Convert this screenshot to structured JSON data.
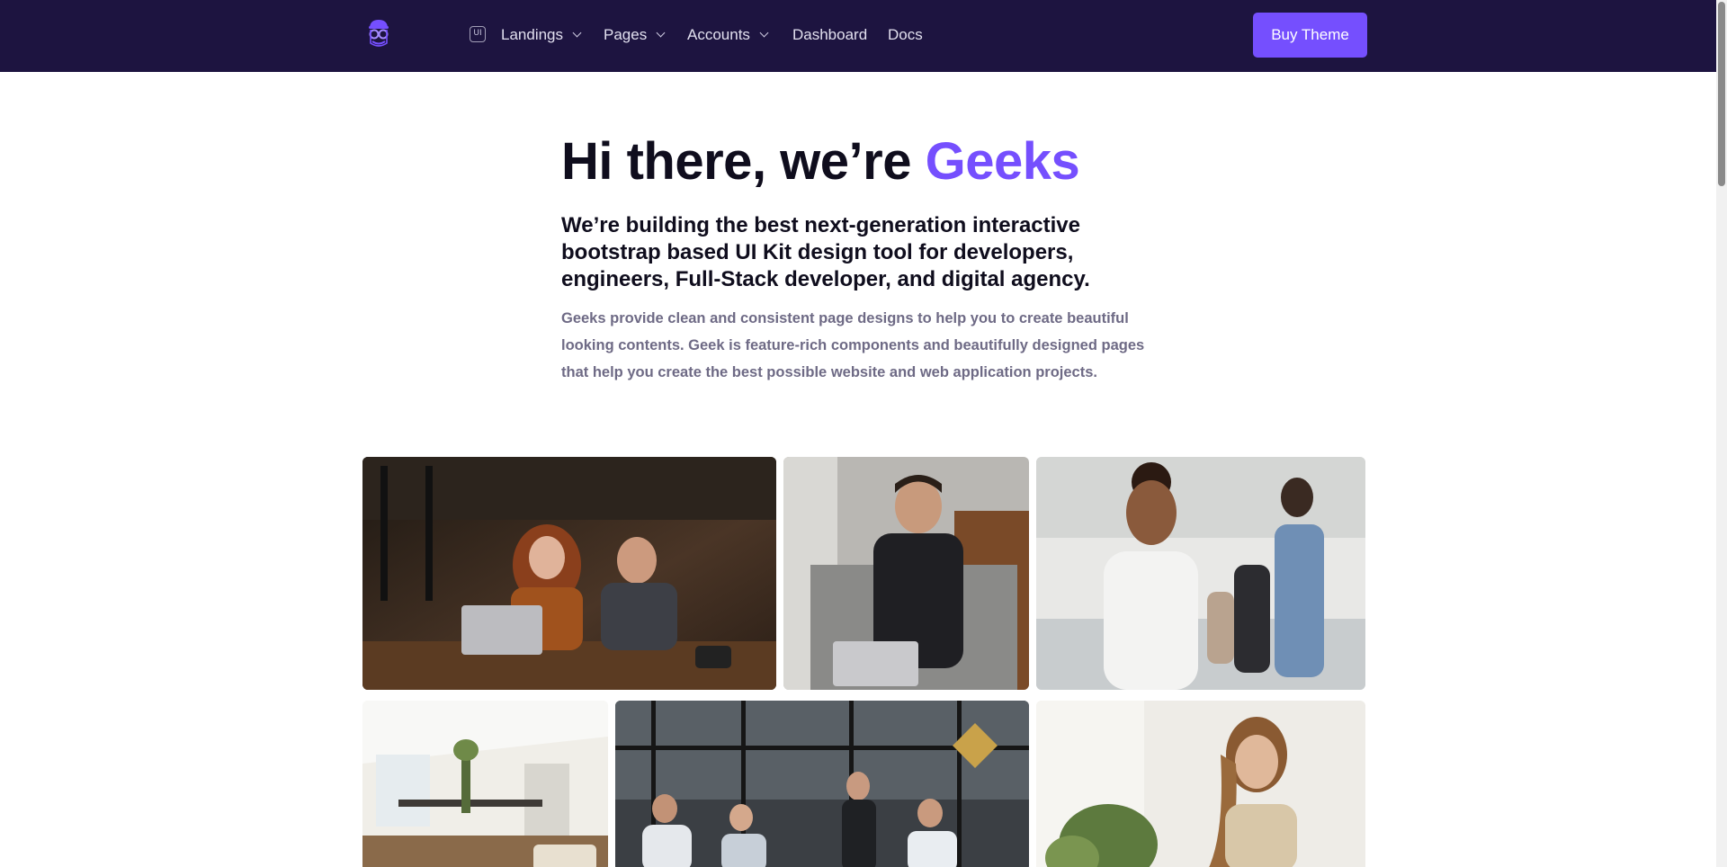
{
  "nav": {
    "logo_icon": "geek-glasses-logo-icon",
    "ui_badge": "UI",
    "items": [
      {
        "label": "Landings",
        "dropdown": true
      },
      {
        "label": "Pages",
        "dropdown": true
      },
      {
        "label": "Accounts",
        "dropdown": true
      },
      {
        "label": "Dashboard",
        "dropdown": false
      },
      {
        "label": "Docs",
        "dropdown": false
      }
    ],
    "cta_label": "Buy Theme"
  },
  "hero": {
    "title_prefix": "Hi there, we’re ",
    "title_accent": "Geeks",
    "subtitle": "We’re building the best next-generation interactive bootstrap based UI Kit design tool for developers, engineers, Full-Stack developer, and digital agency.",
    "description": "Geeks provide clean and consistent page designs to help you to create beautiful looking contents. Geek is feature-rich components and beautifully designed pages that help you create the best possible website and web application projects."
  },
  "gallery": {
    "photos": [
      {
        "name": "photo-cafe-laptop-couple"
      },
      {
        "name": "photo-man-laptop-office"
      },
      {
        "name": "photo-woman-smiling-team"
      },
      {
        "name": "photo-bright-workspace"
      },
      {
        "name": "photo-team-meeting-glass-office"
      },
      {
        "name": "photo-woman-smiling-plants"
      }
    ]
  },
  "colors": {
    "navbar_bg": "#1d1440",
    "accent": "#754ffe",
    "heading": "#0f0d1d",
    "muted": "#6e6a85"
  }
}
